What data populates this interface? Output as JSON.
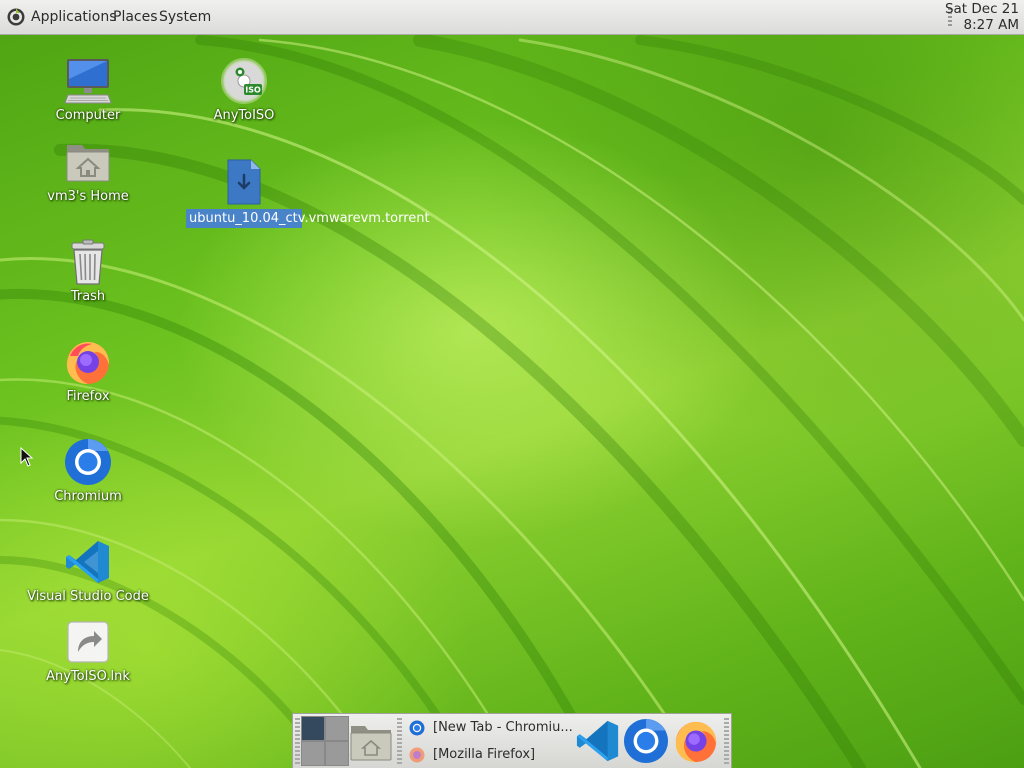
{
  "top_panel": {
    "menus": [
      "Applications",
      "Places",
      "System"
    ],
    "clock": {
      "date": "Sat Dec 21",
      "time": "8:27 AM"
    }
  },
  "desktop": {
    "icons": [
      {
        "label": "Computer",
        "icon": "computer-icon"
      },
      {
        "label": "vm3's Home",
        "icon": "home-folder-icon"
      },
      {
        "label": "Trash",
        "icon": "trash-icon"
      },
      {
        "label": "Firefox",
        "icon": "firefox-icon"
      },
      {
        "label": "Chromium",
        "icon": "chromium-icon"
      },
      {
        "label": "Visual Studio Code",
        "icon": "vscode-icon"
      },
      {
        "label": "AnyToISO.lnk",
        "icon": "shortcut-icon"
      },
      {
        "label": "AnyToISO",
        "icon": "anytoiso-icon"
      },
      {
        "label": "ubuntu_10.04_ctv.vmwarevm.torrent",
        "icon": "torrent-file-icon",
        "selected": true
      }
    ]
  },
  "bottom_panel": {
    "tasks": [
      {
        "label": "[New Tab - Chromiu...",
        "icon": "chromium-icon"
      },
      {
        "label": "[Mozilla Firefox]",
        "icon": "firefox-icon"
      }
    ],
    "launchers": [
      "vscode-icon",
      "chromium-icon",
      "firefox-icon"
    ]
  },
  "colors": {
    "selection": "#4a84c8",
    "wallpaper": "#6cc21f",
    "panel": "#e6e6e4"
  }
}
